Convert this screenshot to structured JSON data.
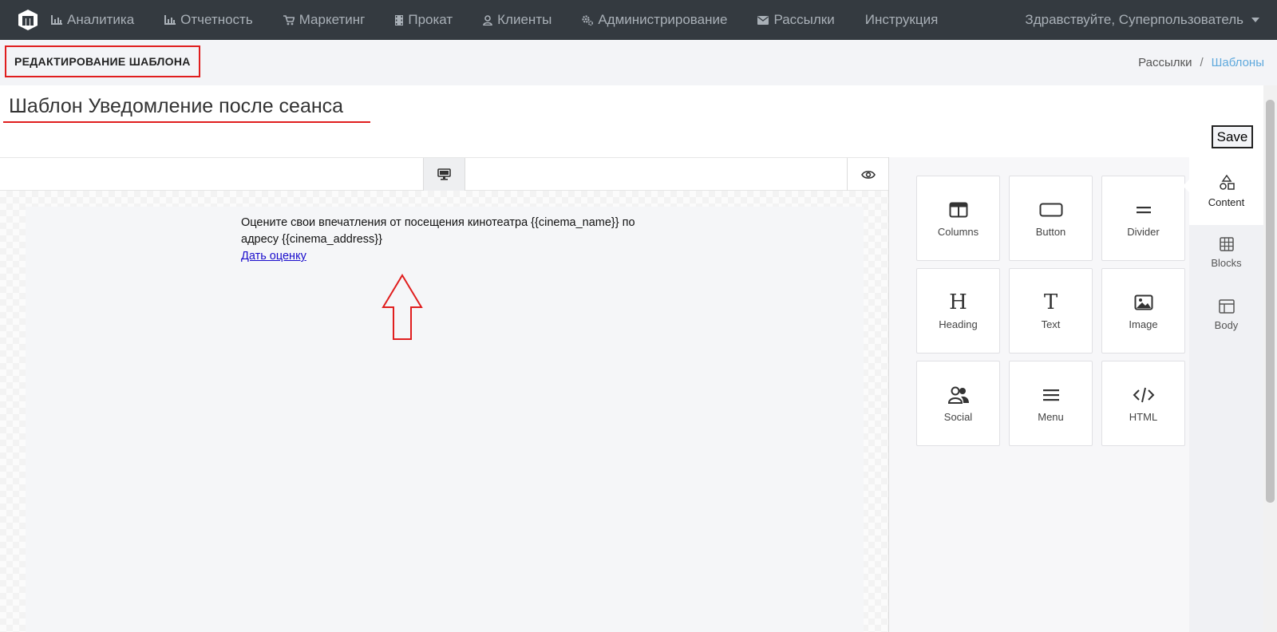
{
  "nav": {
    "items": [
      {
        "label": "Аналитика",
        "icon": "bar-chart-icon"
      },
      {
        "label": "Отчетность",
        "icon": "bar-chart-icon"
      },
      {
        "label": "Маркетинг",
        "icon": "cart-icon"
      },
      {
        "label": "Прокат",
        "icon": "film-icon"
      },
      {
        "label": "Клиенты",
        "icon": "user-icon"
      },
      {
        "label": "Администрирование",
        "icon": "gears-icon"
      },
      {
        "label": "Рассылки",
        "icon": "envelope-icon"
      },
      {
        "label": "Инструкция",
        "icon": ""
      }
    ],
    "user": "Здравствуйте, Суперпользователь"
  },
  "header": {
    "title": "РЕДАКТИРОВАНИЕ ШАБЛОНА",
    "breadcrumb": [
      "Рассылки",
      "Шаблоны"
    ]
  },
  "template": {
    "name": "Шаблон Уведомление после сеанса",
    "save_label": "Save"
  },
  "email": {
    "text": "Оцените свои впечатления от посещения кинотеатра {{cinema_name}} по адресу {{cinema_address}}",
    "link": "Дать оценку"
  },
  "tools": [
    {
      "label": "Columns",
      "icon": "columns-icon"
    },
    {
      "label": "Button",
      "icon": "button-icon"
    },
    {
      "label": "Divider",
      "icon": "divider-icon"
    },
    {
      "label": "Heading",
      "icon": "heading-icon"
    },
    {
      "label": "Text",
      "icon": "text-icon"
    },
    {
      "label": "Image",
      "icon": "image-icon"
    },
    {
      "label": "Social",
      "icon": "social-icon"
    },
    {
      "label": "Menu",
      "icon": "menu-icon"
    },
    {
      "label": "HTML",
      "icon": "code-icon"
    }
  ],
  "tabs": [
    {
      "label": "Content",
      "icon": "shapes-icon",
      "active": true
    },
    {
      "label": "Blocks",
      "icon": "blocks-icon",
      "active": false
    },
    {
      "label": "Body",
      "icon": "body-layout-icon",
      "active": false
    }
  ],
  "colors": {
    "nav_bg": "#343a40",
    "highlight": "#e01e1e",
    "breadcrumb_active": "#5fa9dd",
    "link": "#1a0dcc"
  }
}
